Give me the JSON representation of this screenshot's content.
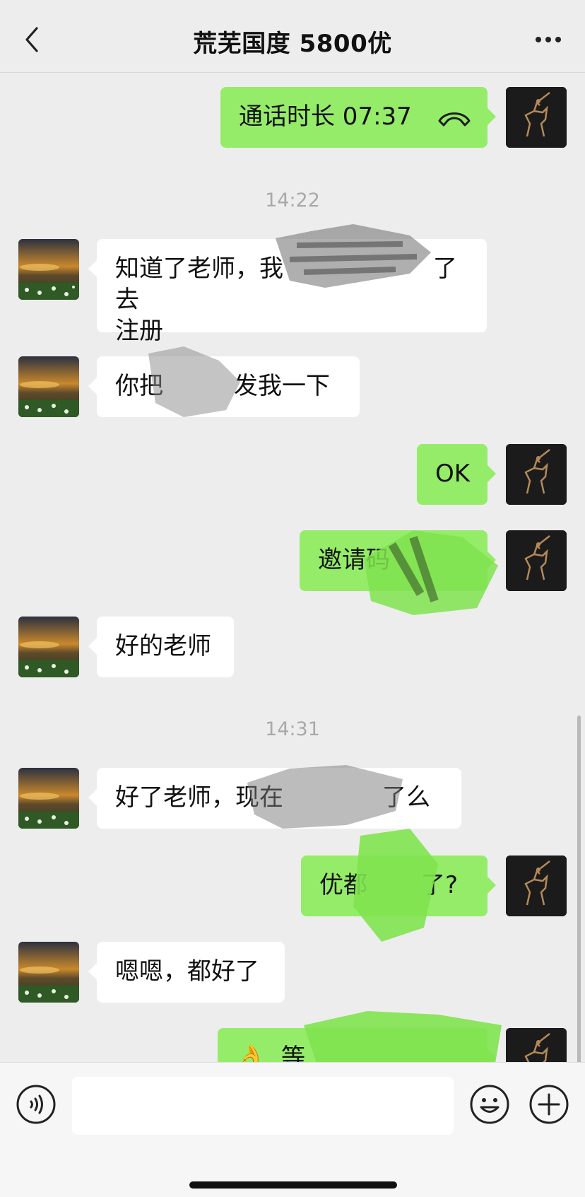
{
  "header": {
    "title": "荒芜国度 5800优"
  },
  "messages": [
    {
      "side": "out",
      "text": "通话时长 07:37",
      "icon": "phone-hangup-icon"
    },
    {
      "side": "time",
      "text": "14:22"
    },
    {
      "side": "in",
      "line1": "知道了老师，我",
      "line1_tail": "了去",
      "line2": "注册"
    },
    {
      "side": "in",
      "text": "你把",
      "tail": "发我一下"
    },
    {
      "side": "out",
      "text": "OK"
    },
    {
      "side": "out",
      "text": "邀请码"
    },
    {
      "side": "in",
      "text": "好的老师"
    },
    {
      "side": "time",
      "text": "14:31"
    },
    {
      "side": "in",
      "text": "好了老师，现在",
      "tail": "了么"
    },
    {
      "side": "out",
      "text": "优都",
      "tail": "了?"
    },
    {
      "side": "in",
      "text": "嗯嗯，都好了"
    },
    {
      "side": "out",
      "text": "等",
      "icon": "ok-hand-icon"
    }
  ],
  "colors": {
    "outgoing": "#95ec69",
    "incoming": "#ffffff",
    "background": "#ededed"
  },
  "input": {
    "placeholder": ""
  }
}
